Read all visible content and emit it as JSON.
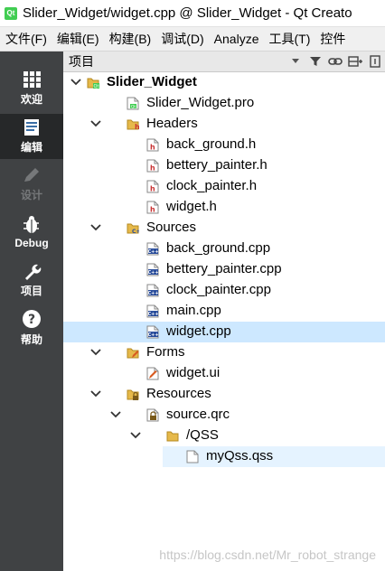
{
  "window": {
    "title": "Slider_Widget/widget.cpp @ Slider_Widget - Qt Creato",
    "app_icon": "qt-logo-icon"
  },
  "menu": [
    {
      "label": "文件(F)"
    },
    {
      "label": "编辑(E)"
    },
    {
      "label": "构建(B)"
    },
    {
      "label": "调试(D)"
    },
    {
      "label": "Analyze"
    },
    {
      "label": "工具(T)"
    },
    {
      "label": "控件"
    }
  ],
  "modes": [
    {
      "label": "欢迎",
      "icon": "welcome-grid-icon"
    },
    {
      "label": "编辑",
      "icon": "edit-document-icon"
    },
    {
      "label": "设计",
      "icon": "design-pencil-icon"
    },
    {
      "label": "Debug",
      "icon": "debug-bug-icon"
    },
    {
      "label": "项目",
      "icon": "projects-wrench-icon"
    },
    {
      "label": "帮助",
      "icon": "help-question-icon"
    }
  ],
  "panel": {
    "title": "项目",
    "icons": [
      "dropdown-arrow-icon",
      "filter-icon",
      "link-icon",
      "split-icon",
      "close-panel-icon"
    ]
  },
  "tree": [
    {
      "label": "Slider_Widget",
      "depth": 0,
      "expanded": true,
      "icon": "project-folder-icon",
      "bold": true
    },
    {
      "label": "Slider_Widget.pro",
      "depth": 1,
      "icon": "pro-file-icon"
    },
    {
      "label": "Headers",
      "depth": 1,
      "expanded": true,
      "icon": "headers-folder-icon"
    },
    {
      "label": "back_ground.h",
      "depth": 2,
      "icon": "header-file-icon"
    },
    {
      "label": "bettery_painter.h",
      "depth": 2,
      "icon": "header-file-icon"
    },
    {
      "label": "clock_painter.h",
      "depth": 2,
      "icon": "header-file-icon"
    },
    {
      "label": "widget.h",
      "depth": 2,
      "icon": "header-file-icon"
    },
    {
      "label": "Sources",
      "depth": 1,
      "expanded": true,
      "icon": "sources-folder-icon"
    },
    {
      "label": "back_ground.cpp",
      "depth": 2,
      "icon": "cpp-file-icon"
    },
    {
      "label": "bettery_painter.cpp",
      "depth": 2,
      "icon": "cpp-file-icon"
    },
    {
      "label": "clock_painter.cpp",
      "depth": 2,
      "icon": "cpp-file-icon"
    },
    {
      "label": "main.cpp",
      "depth": 2,
      "icon": "cpp-file-icon"
    },
    {
      "label": "widget.cpp",
      "depth": 2,
      "icon": "cpp-file-icon",
      "selected": true
    },
    {
      "label": "Forms",
      "depth": 1,
      "expanded": true,
      "icon": "forms-folder-icon"
    },
    {
      "label": "widget.ui",
      "depth": 2,
      "icon": "ui-file-icon"
    },
    {
      "label": "Resources",
      "depth": 1,
      "expanded": true,
      "icon": "resources-folder-icon"
    },
    {
      "label": "source.qrc",
      "depth": 2,
      "expanded": true,
      "icon": "qrc-file-icon"
    },
    {
      "label": "/QSS",
      "depth": 3,
      "expanded": true,
      "icon": "folder-icon"
    },
    {
      "label": "myQss.qss",
      "depth": 4,
      "icon": "plain-file-icon",
      "highlighted": true
    }
  ],
  "watermark": "https://blog.csdn.net/Mr_robot_strange",
  "colors": {
    "modebar": "#404244",
    "selection": "#cde8ff",
    "panel_header": "#e8e8e8"
  }
}
